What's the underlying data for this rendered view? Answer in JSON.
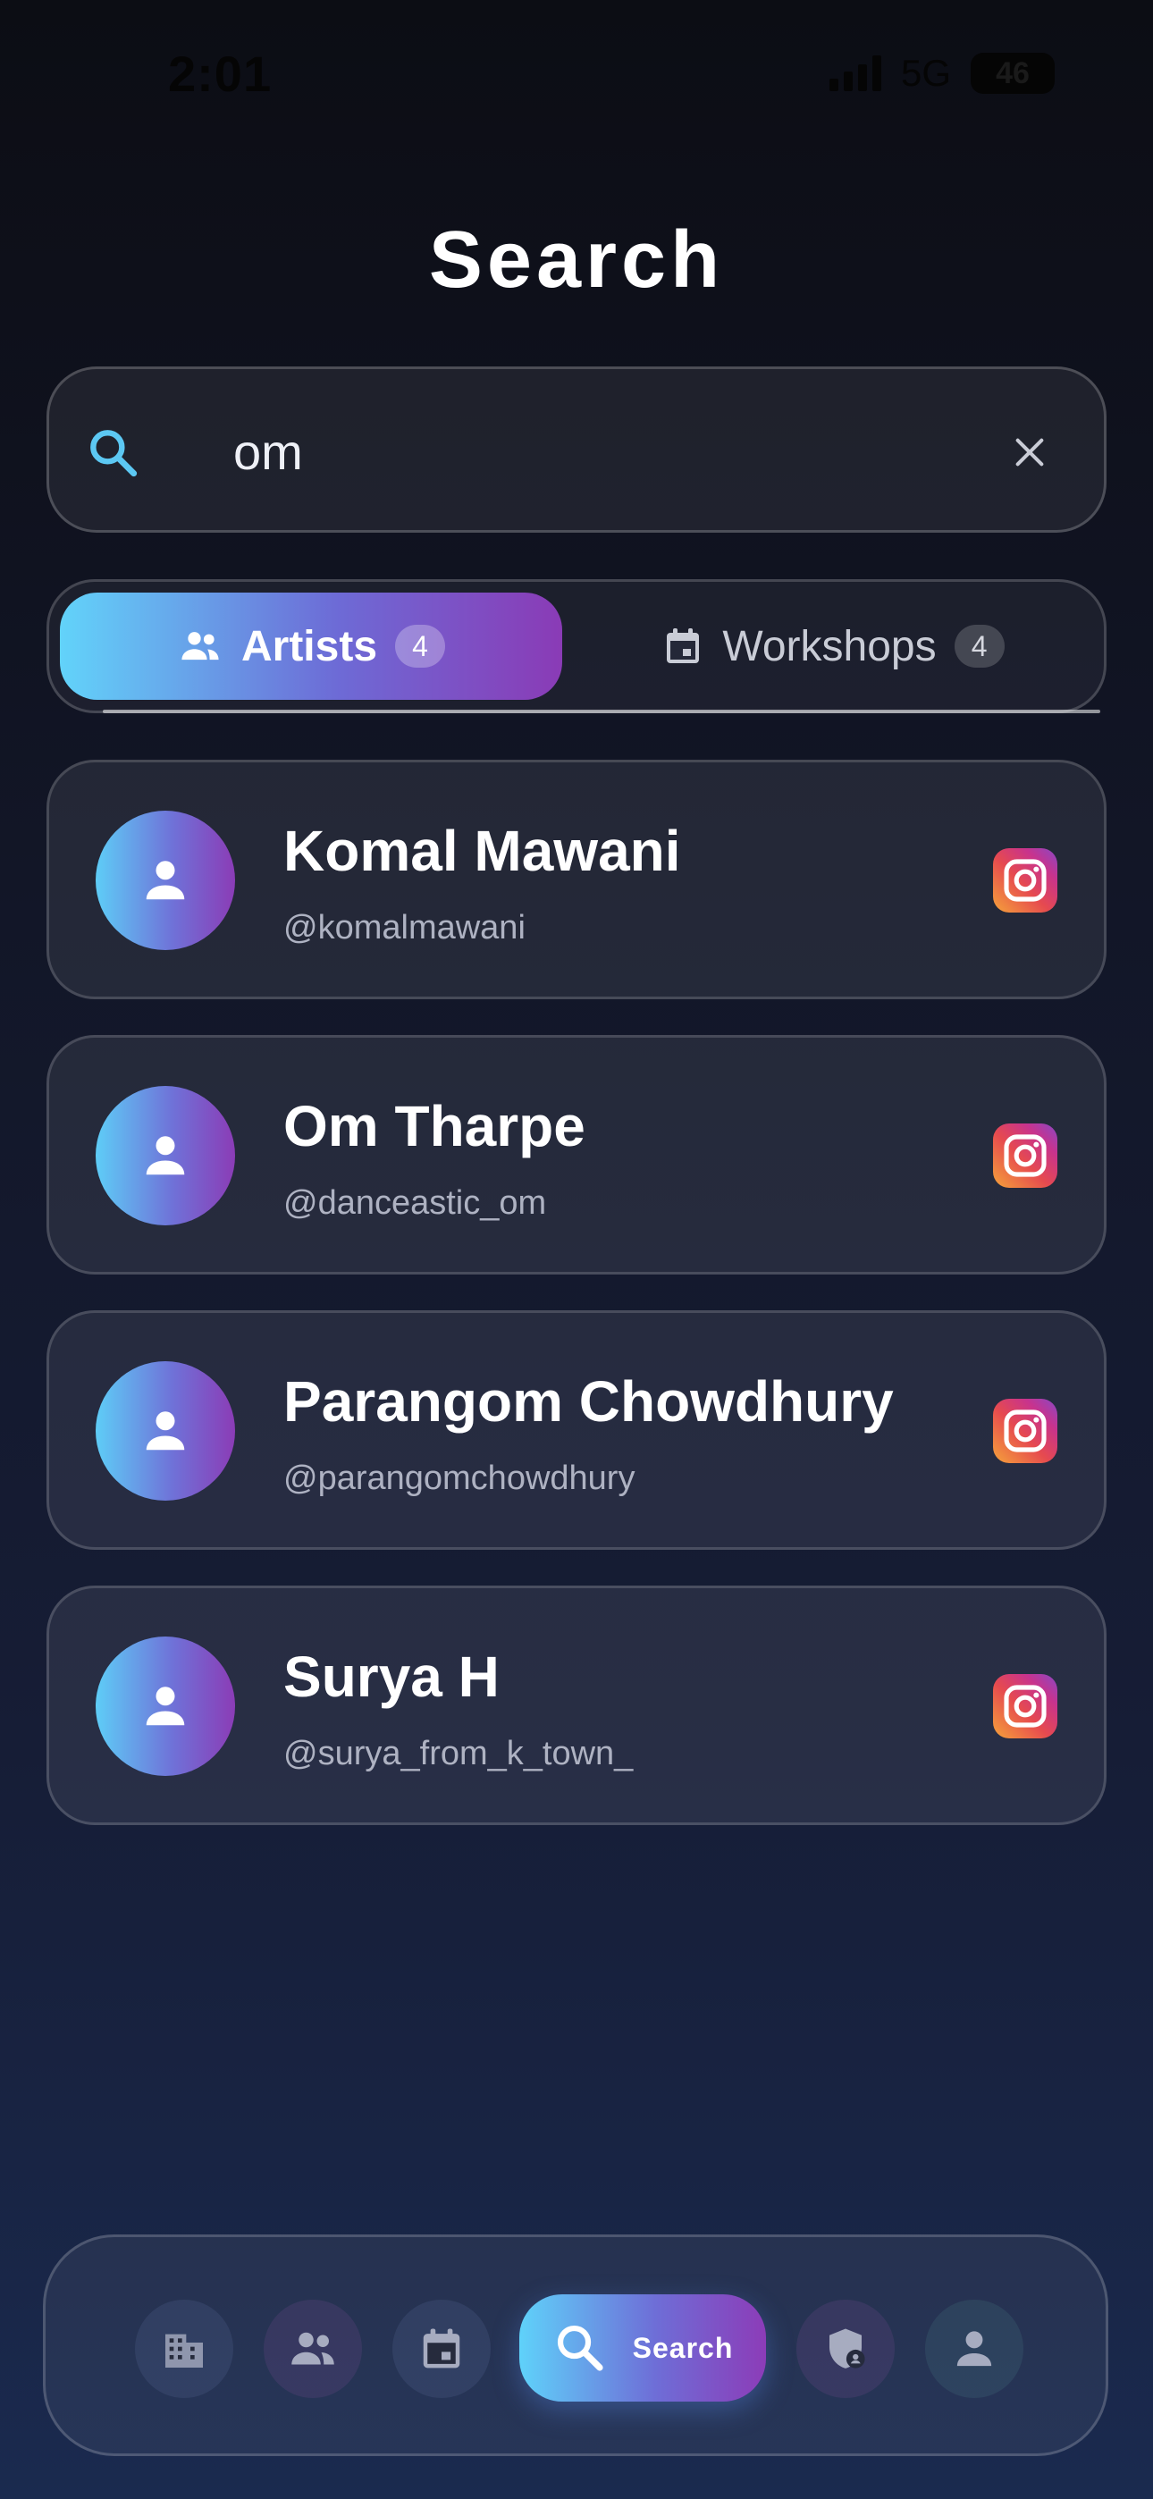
{
  "status_bar": {
    "time": "2:01",
    "network": "5G",
    "battery": "46"
  },
  "page": {
    "title": "Search"
  },
  "search": {
    "value": "om",
    "placeholder": ""
  },
  "tabs": [
    {
      "label": "Artists",
      "count": "4",
      "icon": "people-icon",
      "active": true
    },
    {
      "label": "Workshops",
      "count": "4",
      "icon": "calendar-icon",
      "active": false
    }
  ],
  "results": [
    {
      "name": "Komal Mawani",
      "handle": "@komalmawani",
      "icon": "instagram-icon"
    },
    {
      "name": "Om Tharpe",
      "handle": "@danceastic_om",
      "icon": "instagram-icon"
    },
    {
      "name": "Parangom Chowdhury",
      "handle": "@parangomchowdhury",
      "icon": "instagram-icon"
    },
    {
      "name": "Surya H",
      "handle": "@surya_from_k_town_",
      "icon": "instagram-icon"
    }
  ],
  "bottom_nav": {
    "items": [
      {
        "icon": "building-icon"
      },
      {
        "icon": "people-icon"
      },
      {
        "icon": "calendar-icon"
      },
      {
        "icon": "search-icon",
        "label": "Search",
        "active": true
      },
      {
        "icon": "admin-shield-icon"
      },
      {
        "icon": "profile-icon"
      }
    ]
  },
  "colors": {
    "accent_start": "#62d3fa",
    "accent_end": "#8a3bb6",
    "search_icon": "#5cc8f3"
  }
}
